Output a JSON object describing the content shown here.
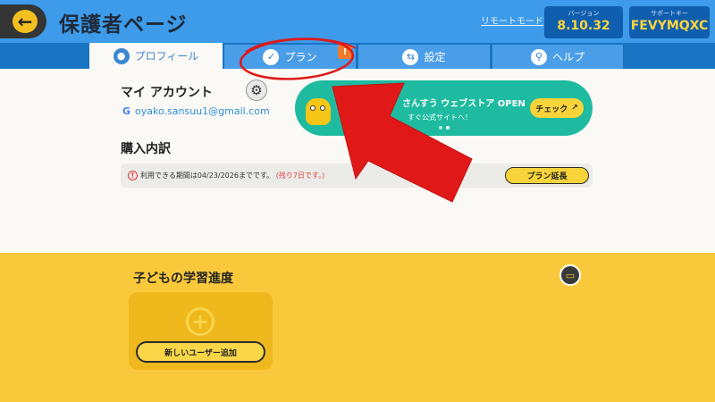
{
  "header": {
    "title": "保護者ページ",
    "remote_mode": "リモートモード",
    "version_label": "バージョン",
    "version_value": "8.10.32",
    "support_label": "サポートキー",
    "support_value": "FEVYMQXC"
  },
  "tabs": [
    {
      "label": "プロフィール",
      "icon": "person-icon",
      "active": true
    },
    {
      "label": "プラン",
      "icon": "checklist-icon",
      "badge": "!"
    },
    {
      "label": "設定",
      "icon": "toggle-icon"
    },
    {
      "label": "ヘルプ",
      "icon": "magnifier-icon"
    }
  ],
  "account": {
    "title": "マイ アカウント",
    "email": "oyako.sansuu1@gmail.com",
    "google_glyph": "G"
  },
  "banner": {
    "title": "さんすう ウェブストア OPEN",
    "subtitle": "すぐ公式サイトへ！",
    "button": "チェック"
  },
  "purchase": {
    "title": "購入内訳",
    "notice": "利用できる期間は04/23/2026までです。",
    "remaining": "(残り7日です。)",
    "extend_button": "プラン延長"
  },
  "progress": {
    "title": "子どもの学習進度",
    "add_user_button": "新しいユーザー追加"
  },
  "colors": {
    "header_blue": "#3d9be9",
    "tab_bar": "#1a74c4",
    "accent_yellow": "#fac93b",
    "banner_green": "#1ebba0",
    "annotation_red": "#e01818"
  }
}
